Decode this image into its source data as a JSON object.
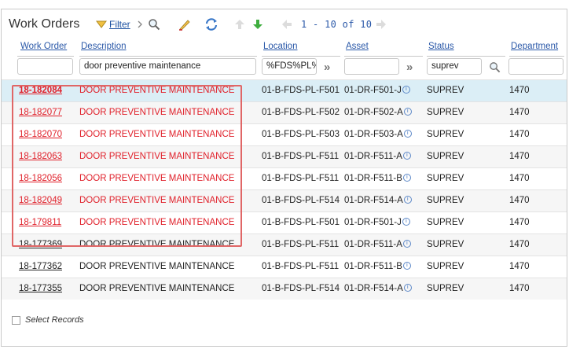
{
  "toolbar": {
    "title": "Work Orders",
    "filter_label": "Filter",
    "pager_text": "1 - 10 of 10"
  },
  "columns": [
    {
      "key": "work_order",
      "label": "Work Order"
    },
    {
      "key": "description",
      "label": "Description"
    },
    {
      "key": "location",
      "label": "Location"
    },
    {
      "key": "asset",
      "label": "Asset"
    },
    {
      "key": "status",
      "label": "Status"
    },
    {
      "key": "department",
      "label": "Department"
    }
  ],
  "filters": {
    "work_order": "",
    "description": "door preventive maintenance",
    "location": "%FDS%PL%",
    "asset": "",
    "status": "suprev",
    "department": ""
  },
  "rows": [
    {
      "work_order": "18-182084",
      "description": "DOOR PREVENTIVE MAINTENANCE",
      "location": "01-B-FDS-PL-F501",
      "asset": "01-DR-F501-J",
      "status": "SUPREV",
      "department": "1470"
    },
    {
      "work_order": "18-182077",
      "description": "DOOR PREVENTIVE MAINTENANCE",
      "location": "01-B-FDS-PL-F502",
      "asset": "01-DR-F502-A",
      "status": "SUPREV",
      "department": "1470"
    },
    {
      "work_order": "18-182070",
      "description": "DOOR PREVENTIVE MAINTENANCE",
      "location": "01-B-FDS-PL-F503",
      "asset": "01-DR-F503-A",
      "status": "SUPREV",
      "department": "1470"
    },
    {
      "work_order": "18-182063",
      "description": "DOOR PREVENTIVE MAINTENANCE",
      "location": "01-B-FDS-PL-F511",
      "asset": "01-DR-F511-A",
      "status": "SUPREV",
      "department": "1470"
    },
    {
      "work_order": "18-182056",
      "description": "DOOR PREVENTIVE MAINTENANCE",
      "location": "01-B-FDS-PL-F511",
      "asset": "01-DR-F511-B",
      "status": "SUPREV",
      "department": "1470"
    },
    {
      "work_order": "18-182049",
      "description": "DOOR PREVENTIVE MAINTENANCE",
      "location": "01-B-FDS-PL-F514",
      "asset": "01-DR-F514-A",
      "status": "SUPREV",
      "department": "1470"
    },
    {
      "work_order": "18-179811",
      "description": "DOOR PREVENTIVE MAINTENANCE",
      "location": "01-B-FDS-PL-F501",
      "asset": "01-DR-F501-J",
      "status": "SUPREV",
      "department": "1470"
    },
    {
      "work_order": "18-177369",
      "description": "DOOR PREVENTIVE MAINTENANCE",
      "location": "01-B-FDS-PL-F511",
      "asset": "01-DR-F511-A",
      "status": "SUPREV",
      "department": "1470"
    },
    {
      "work_order": "18-177362",
      "description": "DOOR PREVENTIVE MAINTENANCE",
      "location": "01-B-FDS-PL-F511",
      "asset": "01-DR-F511-B",
      "status": "SUPREV",
      "department": "1470"
    },
    {
      "work_order": "18-177355",
      "description": "DOOR PREVENTIVE MAINTENANCE",
      "location": "01-B-FDS-PL-F514",
      "asset": "01-DR-F514-A",
      "status": "SUPREV",
      "department": "1470"
    }
  ],
  "footer": {
    "select_records_label": "Select Records"
  },
  "colors": {
    "highlight_text": "#e0202a",
    "highlight_box": "#e06666",
    "selected_row": "#dbeef6",
    "link": "#2a58a8"
  },
  "icons": [
    "filter-icon",
    "chevron-right-icon",
    "search-icon",
    "clear-icon",
    "refresh-icon",
    "arrow-up-icon",
    "arrow-down-icon",
    "page-prev-icon",
    "page-next-icon",
    "info-icon"
  ]
}
